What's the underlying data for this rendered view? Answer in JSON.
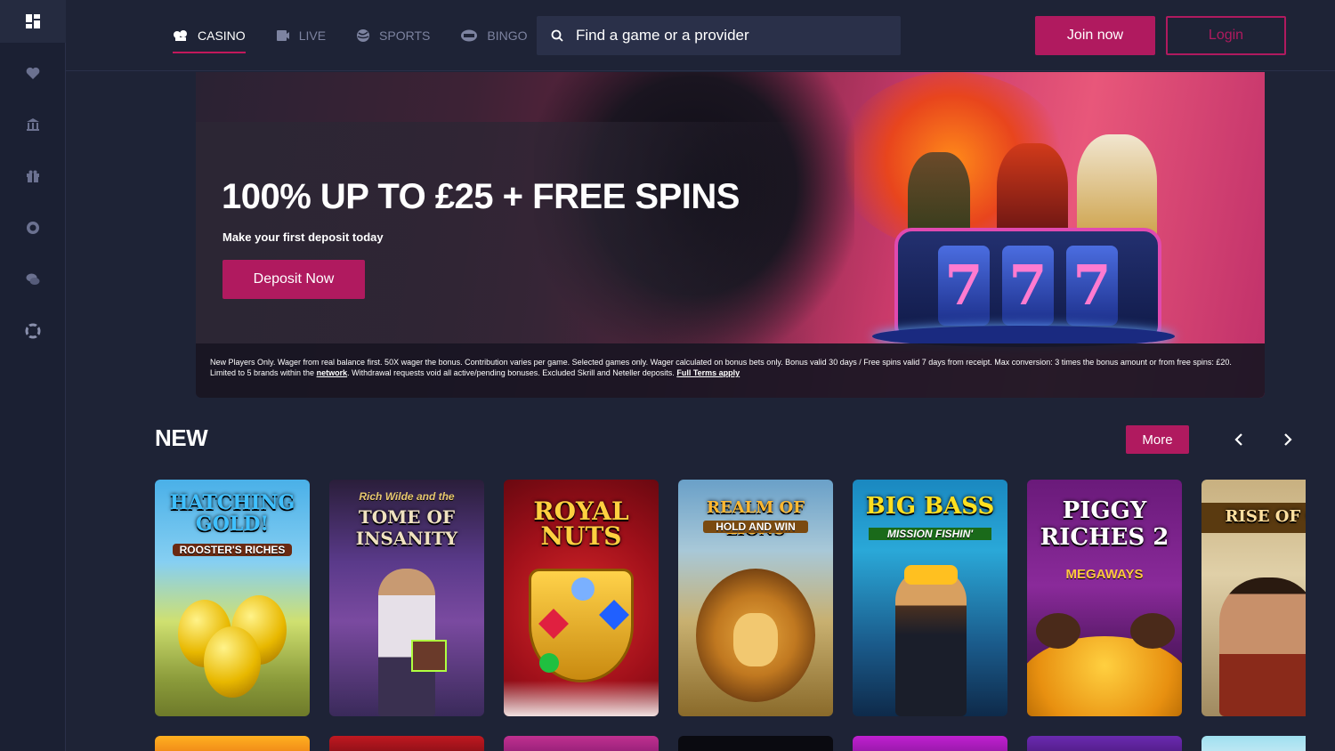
{
  "nav": {
    "items": [
      {
        "label": "CASINO",
        "icon": "casino-icon",
        "active": true
      },
      {
        "label": "LIVE",
        "icon": "live-icon",
        "active": false
      },
      {
        "label": "SPORTS",
        "icon": "sports-icon",
        "active": false
      },
      {
        "label": "BINGO",
        "icon": "bingo-icon",
        "active": false
      }
    ],
    "search_placeholder": "Find a game or a provider",
    "join_label": "Join now",
    "login_label": "Login"
  },
  "sidebar": {
    "icons": [
      "dashboard-icon",
      "heart-icon",
      "bank-icon",
      "gift-icon",
      "chip-icon",
      "chat-icon",
      "support-icon"
    ]
  },
  "banner": {
    "title": "100% UP TO £25 + FREE SPINS",
    "subtitle": "Make your first deposit today",
    "cta": "Deposit Now",
    "reels": [
      "7",
      "7",
      "7"
    ],
    "terms_text": "New Players Only. Wager from real balance first. 50X wager the bonus. Contribution varies per game. Selected games only. Wager calculated on bonus bets only. Bonus valid 30 days / Free spins valid 7 days from receipt. Max conversion: 3 times the bonus amount or from free spins: £20. Limited to 5 brands within the",
    "terms_link": "network",
    "terms_text2": ". Withdrawal requests void all active/pending bonuses. Excluded Skrill and Neteller deposits.",
    "terms_full": "Full Terms apply"
  },
  "new_section": {
    "title": "NEW",
    "more_label": "More",
    "games": [
      {
        "title": "HATCHING GOLD!",
        "subtitle": "ROOSTER'S RICHES"
      },
      {
        "title": "TOME OF INSANITY",
        "subtitle": "Rich Wilde and the"
      },
      {
        "title": "ROYAL NUTS",
        "subtitle": ""
      },
      {
        "title": "REALM OF LIONS",
        "subtitle": "HOLD AND WIN"
      },
      {
        "title": "BIG BASS",
        "subtitle": "MISSION FISHIN'"
      },
      {
        "title": "PIGGY RICHES 2",
        "subtitle": "MEGAWAYS"
      },
      {
        "title": "RISE OF CO",
        "subtitle": ""
      }
    ]
  },
  "colors": {
    "accent": "#b01a5f",
    "background": "#1e2336",
    "sidebar": "#1b2033",
    "search_bg": "#2a3049"
  }
}
